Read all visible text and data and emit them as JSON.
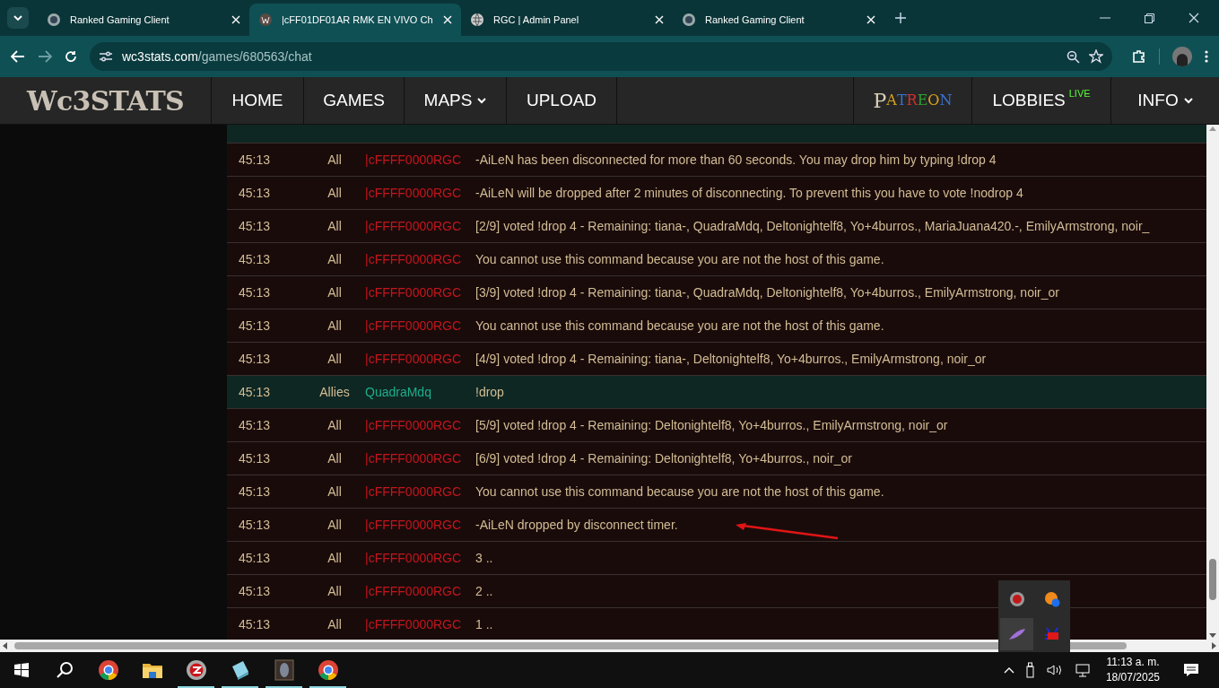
{
  "browser": {
    "tabs": [
      {
        "title": "Ranked Gaming Client",
        "selected": false
      },
      {
        "title": "|cFF01DF01AR RMK EN VIVO Ch",
        "selected": true
      },
      {
        "title": "RGC | Admin Panel",
        "selected": false
      },
      {
        "title": "Ranked Gaming Client",
        "selected": false
      }
    ],
    "address": {
      "host": "wc3stats.com",
      "path": "/games/680563/chat"
    }
  },
  "site_nav": {
    "logo": "Wc3STATS",
    "items": [
      {
        "label": "HOME",
        "dropdown": false
      },
      {
        "label": "GAMES",
        "dropdown": false
      },
      {
        "label": "MAPS",
        "dropdown": true
      },
      {
        "label": "UPLOAD",
        "dropdown": false
      }
    ],
    "right_items": [
      {
        "kind": "patreon",
        "label": "PATREON"
      },
      {
        "kind": "lobbies",
        "label": "LOBBIES",
        "badge": "LIVE"
      },
      {
        "kind": "menu",
        "label": "INFO"
      }
    ]
  },
  "chat": {
    "rows": [
      {
        "kind": "all",
        "time": "45:13",
        "channel": "All",
        "player": "|cFFFF0000RGC",
        "message": "-AiLeN has been disconnected for more than 60 seconds. You may drop him by typing !drop 4"
      },
      {
        "kind": "all",
        "time": "45:13",
        "channel": "All",
        "player": "|cFFFF0000RGC",
        "message": "-AiLeN will be dropped after 2 minutes of disconnecting. To prevent this you have to vote !nodrop 4"
      },
      {
        "kind": "all",
        "time": "45:13",
        "channel": "All",
        "player": "|cFFFF0000RGC",
        "message": "[2/9] voted !drop 4 - Remaining: tiana-, QuadraMdq, Deltonightelf8, Yo+4burros., MariaJuana420.-, EmilyArmstrong, noir_"
      },
      {
        "kind": "all",
        "time": "45:13",
        "channel": "All",
        "player": "|cFFFF0000RGC",
        "message": "You cannot use this command because you are not the host of this game."
      },
      {
        "kind": "all",
        "time": "45:13",
        "channel": "All",
        "player": "|cFFFF0000RGC",
        "message": "[3/9] voted !drop 4 - Remaining: tiana-, QuadraMdq, Deltonightelf8, Yo+4burros., EmilyArmstrong, noir_or"
      },
      {
        "kind": "all",
        "time": "45:13",
        "channel": "All",
        "player": "|cFFFF0000RGC",
        "message": "You cannot use this command because you are not the host of this game."
      },
      {
        "kind": "all",
        "time": "45:13",
        "channel": "All",
        "player": "|cFFFF0000RGC",
        "message": "[4/9] voted !drop 4 - Remaining: tiana-, Deltonightelf8, Yo+4burros., EmilyArmstrong, noir_or"
      },
      {
        "kind": "allies",
        "time": "45:13",
        "channel": "Allies",
        "player": "QuadraMdq",
        "message": "!drop"
      },
      {
        "kind": "all",
        "time": "45:13",
        "channel": "All",
        "player": "|cFFFF0000RGC",
        "message": "[5/9] voted !drop 4 - Remaining: Deltonightelf8, Yo+4burros., EmilyArmstrong, noir_or"
      },
      {
        "kind": "all",
        "time": "45:13",
        "channel": "All",
        "player": "|cFFFF0000RGC",
        "message": "[6/9] voted !drop 4 - Remaining: Deltonightelf8, Yo+4burros., noir_or"
      },
      {
        "kind": "all",
        "time": "45:13",
        "channel": "All",
        "player": "|cFFFF0000RGC",
        "message": "You cannot use this command because you are not the host of this game."
      },
      {
        "kind": "all",
        "time": "45:13",
        "channel": "All",
        "player": "|cFFFF0000RGC",
        "message": "-AiLeN dropped by disconnect timer."
      },
      {
        "kind": "all",
        "time": "45:13",
        "channel": "All",
        "player": "|cFFFF0000RGC",
        "message": "3 .."
      },
      {
        "kind": "all",
        "time": "45:13",
        "channel": "All",
        "player": "|cFFFF0000RGC",
        "message": "2 .."
      },
      {
        "kind": "all",
        "time": "45:13",
        "channel": "All",
        "player": "|cFFFF0000RGC",
        "message": "1 .."
      }
    ]
  },
  "taskbar": {
    "apps": [
      {
        "kind": "chrome",
        "running": false
      },
      {
        "kind": "folder",
        "running": false
      },
      {
        "kind": "rgc",
        "running": true
      },
      {
        "kind": "notepad",
        "running": true
      },
      {
        "kind": "game",
        "running": true
      },
      {
        "kind": "chrome",
        "running": true
      }
    ],
    "time": "11:13 a. m.",
    "date": "18/07/2025"
  }
}
